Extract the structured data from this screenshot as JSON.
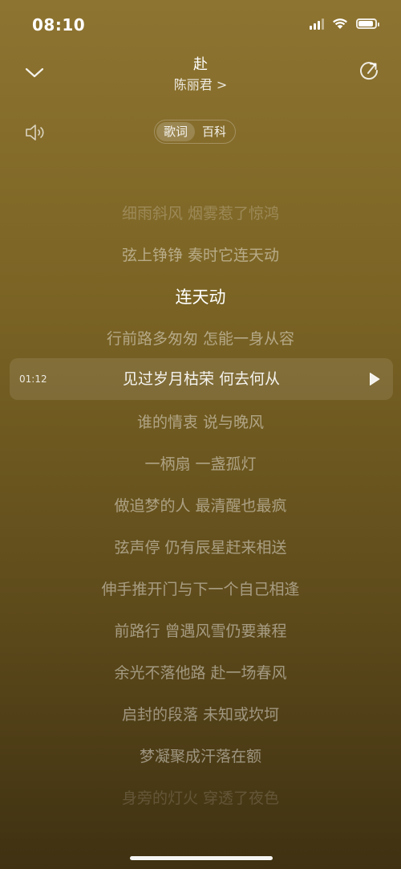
{
  "status_bar": {
    "time": "08:10",
    "battery_level": 0.9
  },
  "header": {
    "song_title": "赴",
    "artist": "陈丽君 >"
  },
  "icons": {
    "collapse": "chevron-down-icon",
    "share": "share-icon",
    "volume": "speaker-icon",
    "play": "play-icon"
  },
  "tabs": [
    {
      "label": "歌词",
      "active": true
    },
    {
      "label": "百科",
      "active": false
    }
  ],
  "lyrics": [
    "细雨斜风 烟雾惹了惊鸿",
    "弦上铮铮 奏时它连天动",
    "连天动",
    "行前路多匆匆 怎能一身从容",
    "见过岁月枯荣 何去何从",
    "谁的情衷 说与晚风",
    "一柄扇 一盏孤灯",
    "做追梦的人 最清醒也最疯",
    "弦声停 仍有辰星赶来相送",
    "伸手推开门与下一个自己相逢",
    "前路行 曾遇风雪仍要兼程",
    "余光不落他路 赴一场春风",
    "启封的段落 未知或坎坷",
    "梦凝聚成汗落在额",
    "身旁的灯火 穿透了夜色"
  ],
  "current_line_index": 2,
  "seek": {
    "time": "01:12",
    "line_index": 4
  }
}
